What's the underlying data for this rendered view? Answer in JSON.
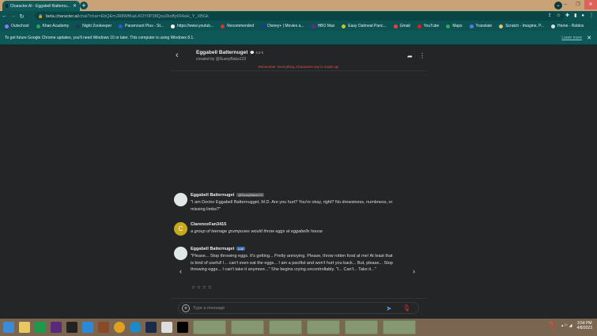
{
  "browser": {
    "tab_title": "Character.AI - Eggabell Batternu...",
    "url_host": "beta.character.ai",
    "url_path": "/chat?char=EbQEmJR8WfKaiLKOY0P38Qsu2koffy004aH_Y_XBGk",
    "bookmarks": [
      "Outschool",
      "Khan Academy",
      "Night Zookeeper",
      "Paramount Plus - St...",
      "https://www.youtub...",
      "Recommended",
      "Disney+ | Movies a...",
      "HBO Max",
      "Easy Oatmeal Panc...",
      "Gmail",
      "YouTube",
      "Maps",
      "Translate",
      "Scratch - Imagine, P...",
      "Home - Roblox"
    ],
    "bookmark_colors": [
      "#8a7cf0",
      "#1fa463",
      "#223355",
      "#1e63d6",
      "#ffffff",
      "#e03030",
      "#1a3aa0",
      "#6a2a8a",
      "#c5c530",
      "#ea4335",
      "#e02020",
      "#34a853",
      "#4a80e0",
      "#e8c070",
      "#dddddd"
    ],
    "infobar_text": "To get future Google Chrome updates, you'll need Windows 10 or later. This computer is using Windows 8.1.",
    "learn_more": "Learn more"
  },
  "chat": {
    "character_name": "Eggabell Batternuget",
    "interaction_count": "4.0 k",
    "created_by": "created by @SussyBaka123",
    "disclaimer": "Remember: Everything Characters say is made up!",
    "messages": [
      {
        "author": "Eggabell Batternuget",
        "tag": "@SussyBaka123",
        "text": "\"I am Doctor Eggabell Batternugget, M.D. Are you hurt? You're okay, right? No drowsiness, numbness, or missing limbs?\""
      },
      {
        "author": "ClarenceFan3415",
        "avatar_letter": "C",
        "text": "a group of teenage grumpuses would throw eggs at eggabells house"
      },
      {
        "author": "Eggabell Batternuget",
        "tag": "c.ai",
        "text": "\"Please... Stop throwing eggs. It's getting... Pretty annoying. Please, throw rotten food at me! At least that is kind of useful! I... can't even eat the eggs... I am a pacifist and won't hurt you back... But, please... Stop throwing eggs... I can't take it anymore...\" She begins crying uncontrollably. \"I... Can't... Take it...\""
      }
    ],
    "rating_stars": "☆☆☆☆",
    "input_placeholder": "Type a message"
  },
  "taskbar": {
    "time": "3:54 PM",
    "date": "4/8/2023"
  }
}
